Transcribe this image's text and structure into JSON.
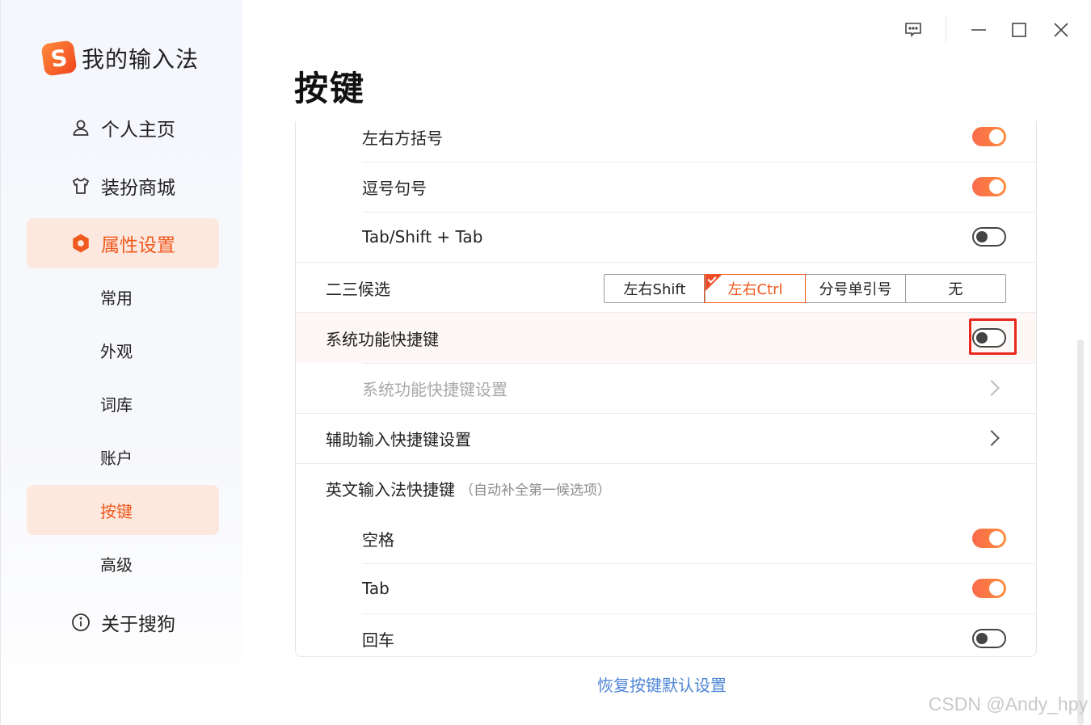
{
  "app": {
    "logo_glyph": "S",
    "title": "我的输入法"
  },
  "sidebar": {
    "items": [
      {
        "label": "个人主页",
        "icon": "user-icon"
      },
      {
        "label": "装扮商城",
        "icon": "shirt-icon"
      },
      {
        "label": "属性设置",
        "icon": "hexagon-settings-icon",
        "active": true
      }
    ],
    "sub_items": [
      {
        "label": "常用"
      },
      {
        "label": "外观"
      },
      {
        "label": "词库"
      },
      {
        "label": "账户"
      },
      {
        "label": "按键",
        "active": true
      },
      {
        "label": "高级"
      }
    ],
    "about": {
      "label": "关于搜狗",
      "icon": "info-icon"
    }
  },
  "page": {
    "title": "按键"
  },
  "settings": {
    "brackets": {
      "label": "左右方括号",
      "on": true
    },
    "comma_period": {
      "label": "逗号句号",
      "on": true
    },
    "tab_shift_tab": {
      "label": "Tab/Shift + Tab",
      "on": false
    },
    "second_third_candidate": {
      "label": "二三候选",
      "options": [
        "左右Shift",
        "左右Ctrl",
        "分号单引号",
        "无"
      ],
      "selected": "左右Ctrl"
    },
    "system_shortcuts": {
      "label": "系统功能快捷键",
      "on": false
    },
    "system_shortcuts_settings": {
      "label": "系统功能快捷键设置"
    },
    "aux_input_shortcuts": {
      "label": "辅助输入快捷键设置"
    },
    "english_shortcuts": {
      "label": "英文输入法快捷键",
      "note": "（自动补全第一候选项）"
    },
    "space": {
      "label": "空格",
      "on": true
    },
    "tab": {
      "label": "Tab",
      "on": true
    },
    "enter": {
      "label": "回车",
      "on": false
    }
  },
  "footer": {
    "reset_label": "恢复按键默认设置"
  },
  "watermark": "CSDN @Andy_hpy",
  "colors": {
    "accent": "#f05a1e",
    "active_bg": "#fde8df",
    "link": "#4f86d6",
    "highlight_box": "#e8281e"
  }
}
